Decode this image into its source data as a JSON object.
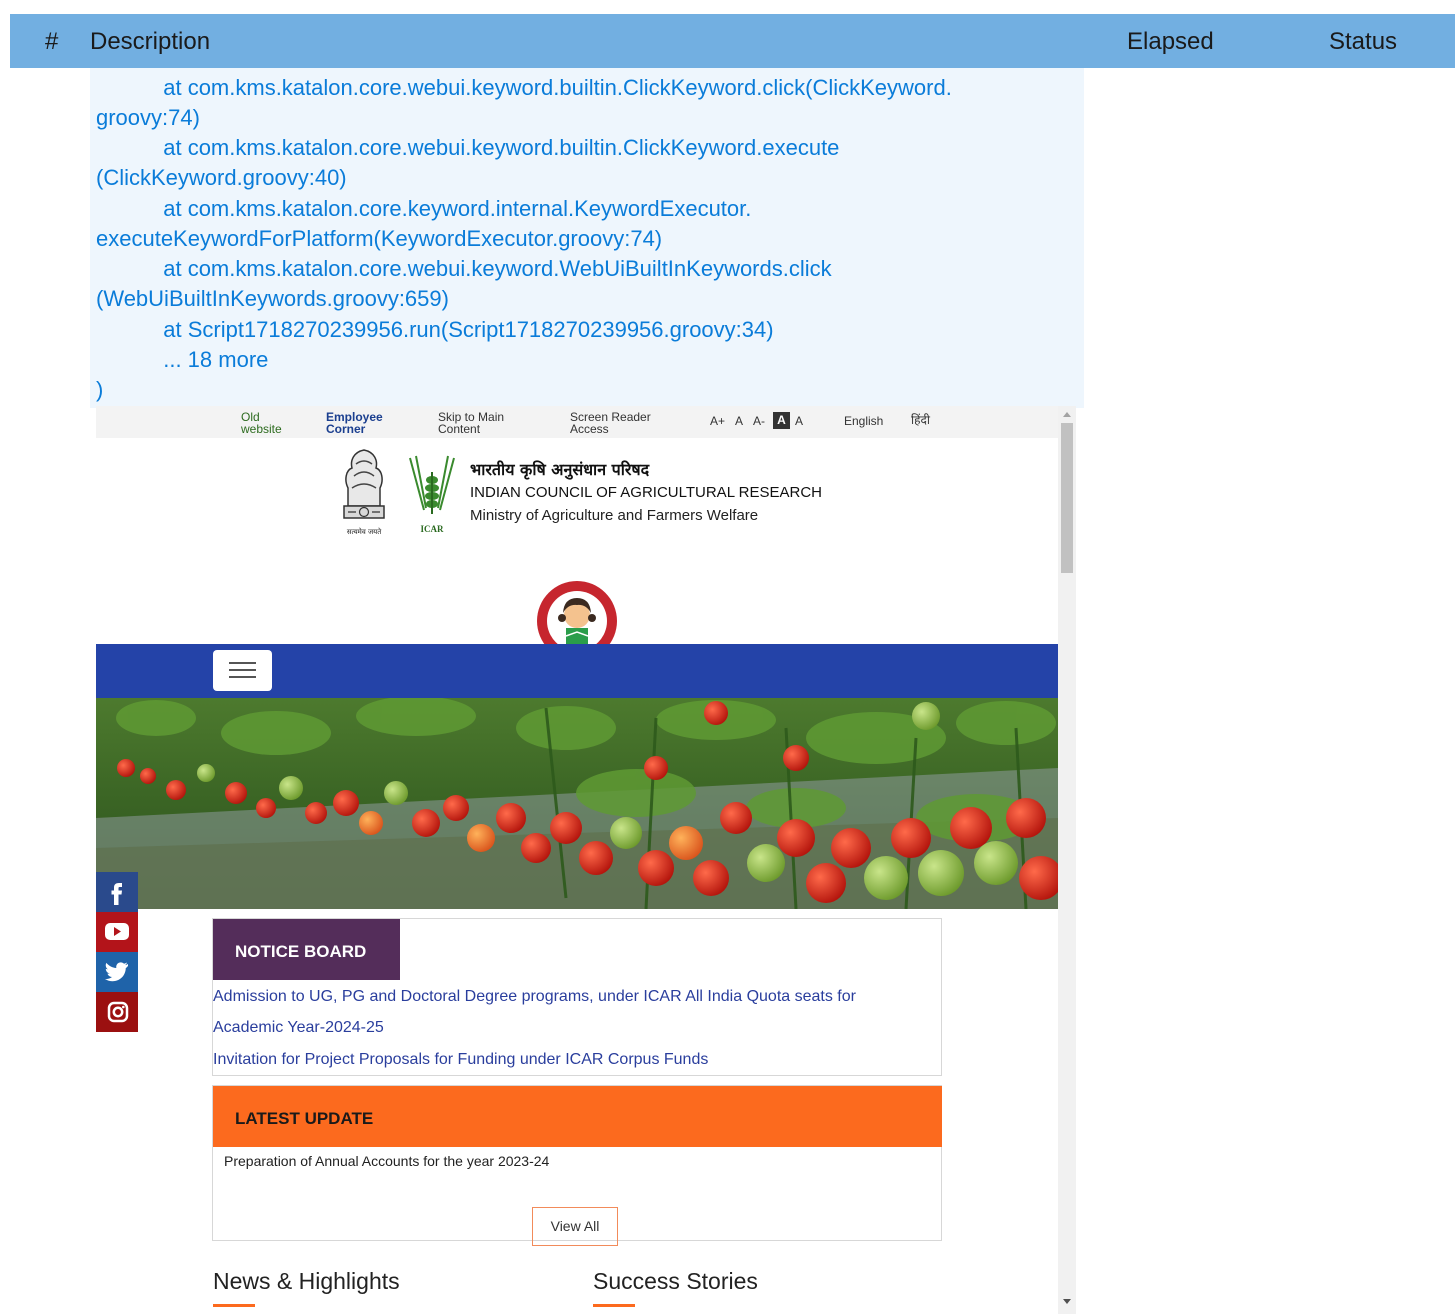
{
  "report": {
    "columns": {
      "num": "#",
      "description": "Description",
      "elapsed": "Elapsed",
      "status": "Status"
    }
  },
  "trace": {
    "lines": [
      "           at com.kms.katalon.core.webui.keyword.builtin.ClickKeyword.click(ClickKeyword.",
      "groovy:74)",
      "           at com.kms.katalon.core.webui.keyword.builtin.ClickKeyword.execute",
      "(ClickKeyword.groovy:40)",
      "           at com.kms.katalon.core.keyword.internal.KeywordExecutor.",
      "executeKeywordForPlatform(KeywordExecutor.groovy:74)",
      "           at com.kms.katalon.core.webui.keyword.WebUiBuiltInKeywords.click",
      "(WebUiBuiltInKeywords.groovy:659)",
      "           at Script1718270239956.run(Script1718270239956.groovy:34)",
      "           ... 18 more",
      ")"
    ]
  },
  "site": {
    "topbar": {
      "old_website_1": "Old",
      "old_website_2": "website",
      "employee_1": "Employee",
      "employee_2": "Corner",
      "skip_1": "Skip to Main",
      "skip_2": "Content",
      "reader_1": "Screen Reader",
      "reader_2": "Access",
      "font_plus": "A+",
      "font_normal": "A",
      "font_minus": "A-",
      "contrast_dark": "A",
      "contrast_light": "A",
      "lang_en": "English",
      "lang_hi": "हिंदी"
    },
    "brand": {
      "hindi_title": "भारतीय कृषि अनुसंधान परिषद",
      "english_title": "INDIAN COUNCIL OF AGRICULTURAL RESEARCH",
      "ministry": "Ministry of Agriculture and Farmers Welfare",
      "emblem_motto": "सत्यमेव जयते",
      "icar_logo_text": "ICAR"
    },
    "notice_board": {
      "title": "NOTICE BOARD",
      "items": [
        "Admission to UG, PG and Doctoral Degree programs, under ICAR All India Quota seats for",
        "Academic Year-2024-25",
        "Invitation for Project Proposals for Funding under ICAR Corpus Funds"
      ]
    },
    "latest_update": {
      "title": "LATEST UPDATE",
      "items": [
        "Preparation of Annual Accounts for the year 2023-24"
      ],
      "view_all": "View All"
    },
    "sections": {
      "news": "News & Highlights",
      "success": "Success Stories"
    },
    "social": [
      "facebook-icon",
      "youtube-icon",
      "twitter-icon",
      "instagram-icon"
    ],
    "colors": {
      "report_header": "#72afe1",
      "trace_text": "#0a7cd9",
      "navbar": "#2443a8",
      "notice_header": "#542d5a",
      "latest_header": "#fc6a1e"
    }
  }
}
